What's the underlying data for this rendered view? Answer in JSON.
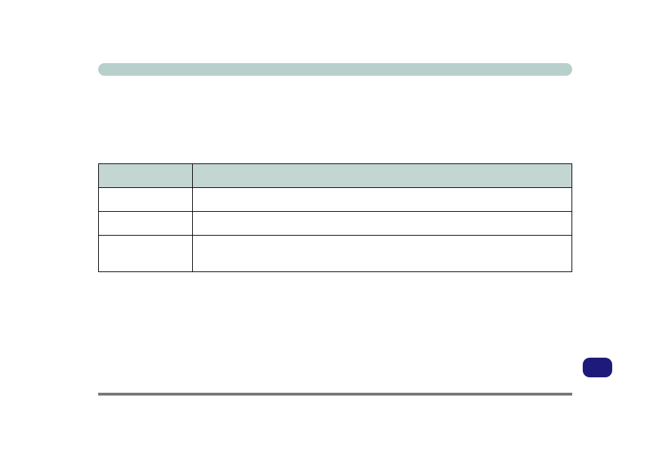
{
  "section": {
    "title": ""
  },
  "table": {
    "columns": [
      "",
      ""
    ],
    "rows": [
      {
        "c1": "",
        "c2": ""
      },
      {
        "c1": "",
        "c2": ""
      },
      {
        "c1": "",
        "c2": ""
      }
    ]
  },
  "page_badge": {
    "label": ""
  }
}
